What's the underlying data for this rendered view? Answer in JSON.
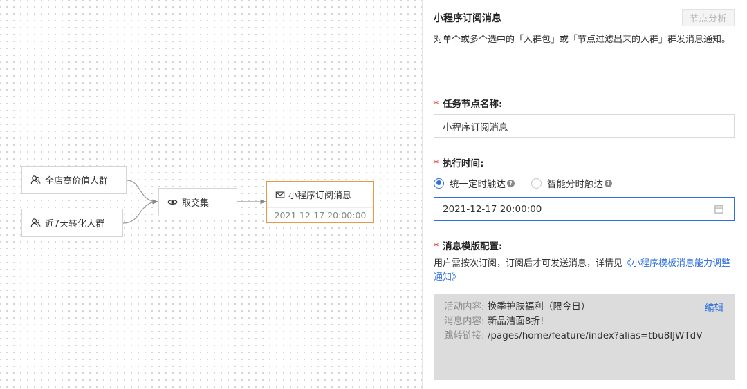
{
  "canvas": {
    "nodes": {
      "high_value": "全店高价值人群",
      "intersect": "取交集",
      "recent7": "近7天转化人群",
      "msg_title": "小程序订阅消息",
      "msg_time": "2021-12-17 20:00:00"
    }
  },
  "panel": {
    "title": "小程序订阅消息",
    "analysis_button": "节点分析",
    "description": "对单个或多个选中的「人群包」或「节点过滤出来的人群」群发消息通知。",
    "required_mark": "*",
    "name_label": "任务节点名称:",
    "name_value": "小程序订阅消息",
    "time_label": "执行时间:",
    "radio_fixed": "统一定时触达",
    "radio_smart": "智能分时触达",
    "datetime_value": "2021-12-17 20:00:00",
    "template_label": "消息模版配置:",
    "template_desc": "用户需按次订阅，订阅后才可发送消息，详情见",
    "template_link": "《小程序模板消息能力调整通知》",
    "template": {
      "activity_key": "活动内容:",
      "activity_value": "换季护肤福利（限今日）",
      "message_key": "消息内容:",
      "message_value": "新品洁面8折!",
      "link_key": "跳转链接:",
      "link_value": "/pages/home/feature/index?alias=tbu8lJWTdV",
      "edit": "编辑"
    }
  },
  "colors": {
    "accent": "#2f6fde",
    "node_selected_border": "#e89a4a",
    "required": "#e5484d"
  }
}
